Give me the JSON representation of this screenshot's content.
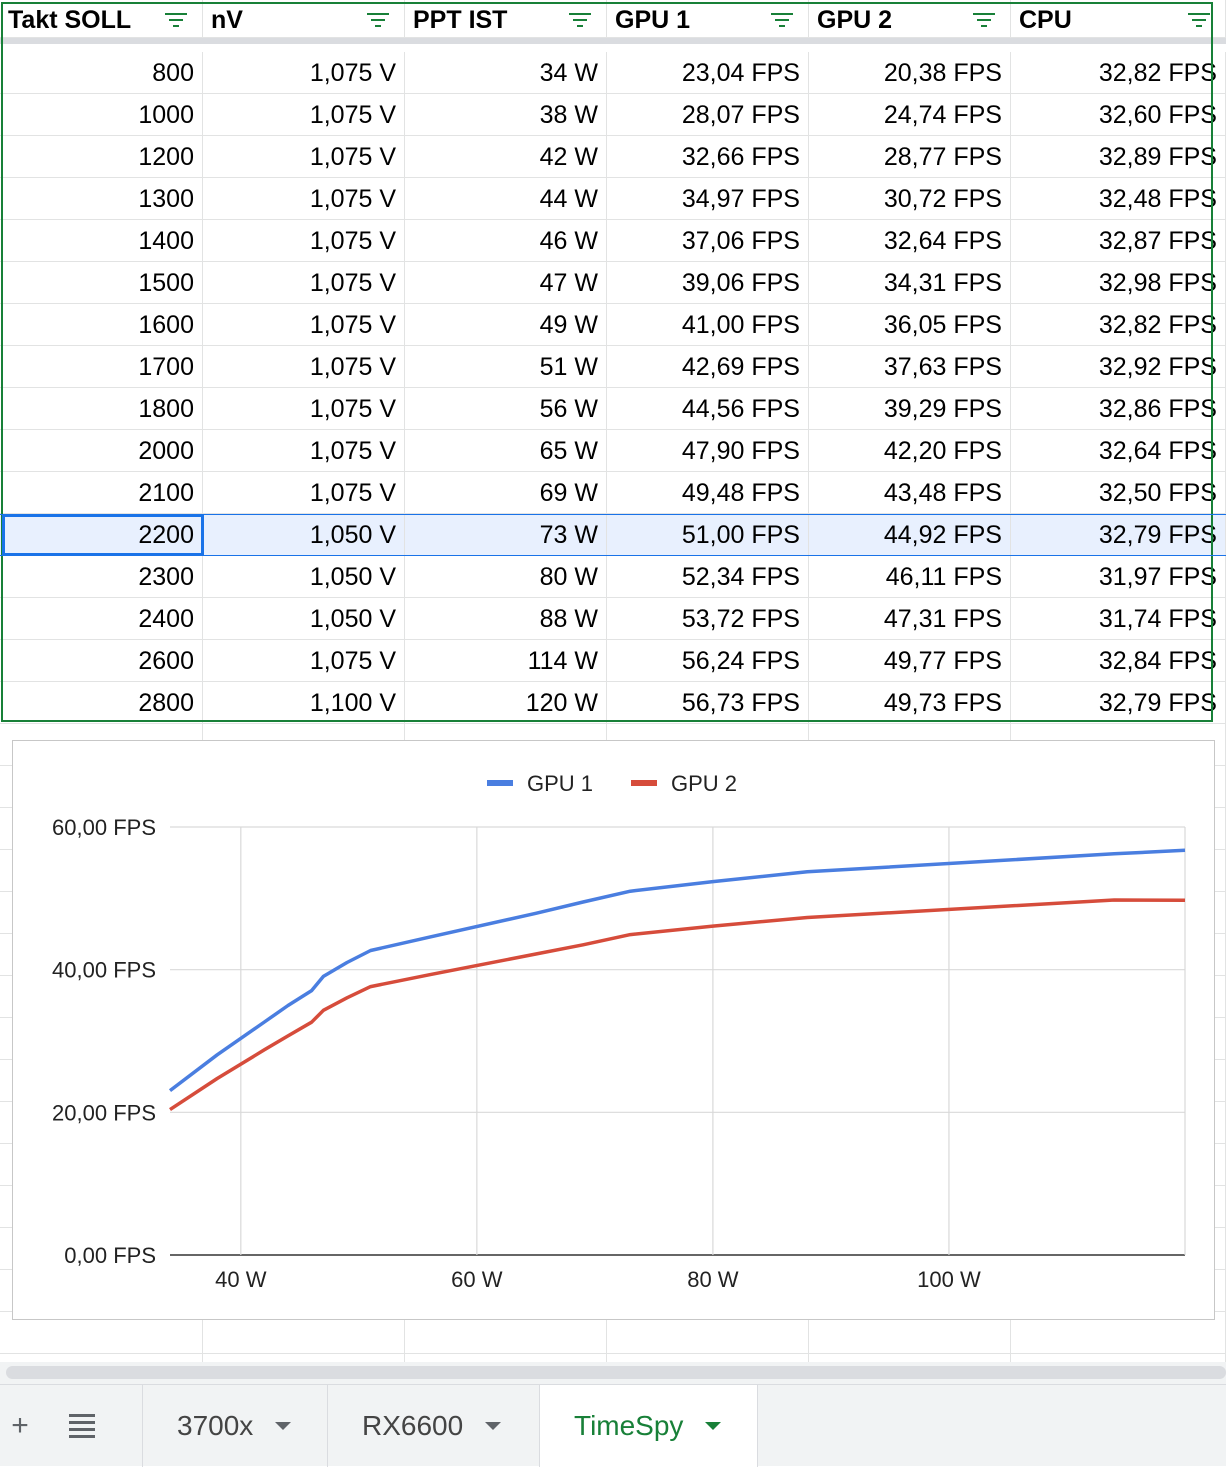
{
  "table": {
    "columns": [
      {
        "key": "takt",
        "label": "Takt SOLL"
      },
      {
        "key": "nv",
        "label": "nV"
      },
      {
        "key": "ppt",
        "label": "PPT IST"
      },
      {
        "key": "gpu1",
        "label": "GPU 1"
      },
      {
        "key": "gpu2",
        "label": "GPU 2"
      },
      {
        "key": "cpu",
        "label": "CPU"
      }
    ],
    "rows": [
      [
        "800",
        "1,075 V",
        "34 W",
        "23,04 FPS",
        "20,38 FPS",
        "32,82 FPS"
      ],
      [
        "1000",
        "1,075 V",
        "38 W",
        "28,07 FPS",
        "24,74 FPS",
        "32,60 FPS"
      ],
      [
        "1200",
        "1,075 V",
        "42 W",
        "32,66 FPS",
        "28,77 FPS",
        "32,89 FPS"
      ],
      [
        "1300",
        "1,075 V",
        "44 W",
        "34,97 FPS",
        "30,72 FPS",
        "32,48 FPS"
      ],
      [
        "1400",
        "1,075 V",
        "46 W",
        "37,06 FPS",
        "32,64 FPS",
        "32,87 FPS"
      ],
      [
        "1500",
        "1,075 V",
        "47 W",
        "39,06 FPS",
        "34,31 FPS",
        "32,98 FPS"
      ],
      [
        "1600",
        "1,075 V",
        "49 W",
        "41,00 FPS",
        "36,05 FPS",
        "32,82 FPS"
      ],
      [
        "1700",
        "1,075 V",
        "51 W",
        "42,69 FPS",
        "37,63 FPS",
        "32,92 FPS"
      ],
      [
        "1800",
        "1,075 V",
        "56 W",
        "44,56 FPS",
        "39,29 FPS",
        "32,86 FPS"
      ],
      [
        "2000",
        "1,075 V",
        "65 W",
        "47,90 FPS",
        "42,20 FPS",
        "32,64 FPS"
      ],
      [
        "2100",
        "1,075 V",
        "69 W",
        "49,48 FPS",
        "43,48 FPS",
        "32,50 FPS"
      ],
      [
        "2200",
        "1,050 V",
        "73 W",
        "51,00 FPS",
        "44,92 FPS",
        "32,79 FPS"
      ],
      [
        "2300",
        "1,050 V",
        "80 W",
        "52,34 FPS",
        "46,11 FPS",
        "31,97 FPS"
      ],
      [
        "2400",
        "1,050 V",
        "88 W",
        "53,72 FPS",
        "47,31 FPS",
        "31,74 FPS"
      ],
      [
        "2600",
        "1,075 V",
        "114 W",
        "56,24 FPS",
        "49,77 FPS",
        "32,84 FPS"
      ],
      [
        "2800",
        "1,100 V",
        "120 W",
        "56,73 FPS",
        "49,73 FPS",
        "32,79 FPS"
      ]
    ],
    "selected_row": 11,
    "filter_icon": "filter-icon",
    "filter_color": "#188038",
    "selection_color": "#1a73e8"
  },
  "chart_data": {
    "type": "line",
    "x": [
      34,
      38,
      42,
      44,
      46,
      47,
      49,
      51,
      56,
      65,
      69,
      73,
      80,
      88,
      114,
      120
    ],
    "series": [
      {
        "name": "GPU 1",
        "color": "#4a7ee0",
        "values": [
          23.04,
          28.07,
          32.66,
          34.97,
          37.06,
          39.06,
          41.0,
          42.69,
          44.56,
          47.9,
          49.48,
          51.0,
          52.34,
          53.72,
          56.24,
          56.73
        ]
      },
      {
        "name": "GPU 2",
        "color": "#d64c3b",
        "values": [
          20.38,
          24.74,
          28.77,
          30.72,
          32.64,
          34.31,
          36.05,
          37.63,
          39.29,
          42.2,
          43.48,
          44.92,
          46.11,
          47.31,
          49.77,
          49.73
        ]
      }
    ],
    "xlim": [
      34,
      120
    ],
    "ylim": [
      0,
      60
    ],
    "x_ticks": [
      {
        "value": 40,
        "label": "40 W"
      },
      {
        "value": 60,
        "label": "60 W"
      },
      {
        "value": 80,
        "label": "80 W"
      },
      {
        "value": 100,
        "label": "100 W"
      }
    ],
    "y_ticks": [
      {
        "value": 0,
        "label": "0,00 FPS"
      },
      {
        "value": 20,
        "label": "20,00 FPS"
      },
      {
        "value": 40,
        "label": "40,00 FPS"
      },
      {
        "value": 60,
        "label": "60,00 FPS"
      }
    ],
    "legend": "top",
    "grid": true
  },
  "bottom_bar": {
    "add_icon": "plus-icon",
    "add_label": "+",
    "menu_icon": "menu-lines-icon",
    "tabs": [
      {
        "label": "3700x",
        "active": false
      },
      {
        "label": "RX6600",
        "active": false
      },
      {
        "label": "TimeSpy",
        "active": true
      }
    ]
  }
}
